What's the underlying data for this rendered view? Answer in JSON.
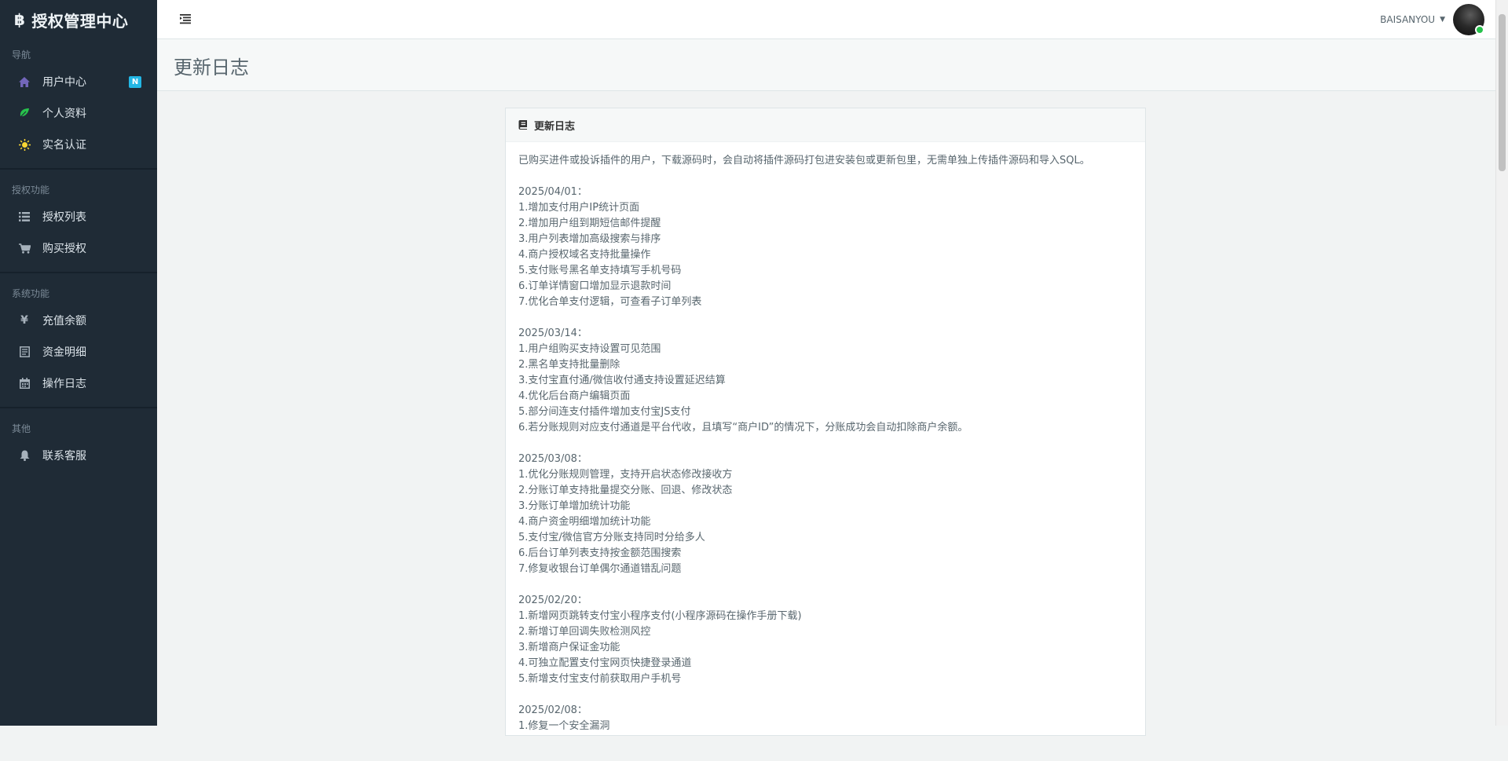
{
  "brand": {
    "logo_glyph": "฿",
    "title": "授权管理中心"
  },
  "sidebar": {
    "sections": [
      {
        "label": "导航",
        "items": [
          {
            "icon": "home-icon",
            "label": "用户中心",
            "badge": "N",
            "icon_color": "#7266ba"
          },
          {
            "icon": "leaf-icon",
            "label": "个人资料",
            "icon_color": "#27c24c"
          },
          {
            "icon": "sun-icon",
            "label": "实名认证",
            "icon_color": "#fad733"
          }
        ]
      },
      {
        "label": "授权功能",
        "items": [
          {
            "icon": "list-icon",
            "label": "授权列表"
          },
          {
            "icon": "cart-icon",
            "label": "购买授权"
          }
        ]
      },
      {
        "label": "系统功能",
        "items": [
          {
            "icon": "yen-icon",
            "label": "充值余额"
          },
          {
            "icon": "ledger-icon",
            "label": "资金明细"
          },
          {
            "icon": "calendar-icon",
            "label": "操作日志"
          }
        ]
      },
      {
        "label": "其他",
        "items": [
          {
            "icon": "bell-icon",
            "label": "联系客服"
          }
        ]
      }
    ]
  },
  "header": {
    "username": "BAISANYOU",
    "caret": "▼"
  },
  "page": {
    "title": "更新日志"
  },
  "panel": {
    "heading": "更新日志",
    "intro": "已购买进件或投诉插件的用户，下载源码时，会自动将插件源码打包进安装包或更新包里，无需单独上传插件源码和导入SQL。",
    "entries": [
      {
        "date": "2025/04/01：",
        "items": [
          "1.增加支付用户IP统计页面",
          "2.增加用户组到期短信邮件提醒",
          "3.用户列表增加高级搜索与排序",
          "4.商户授权域名支持批量操作",
          "5.支付账号黑名单支持填写手机号码",
          "6.订单详情窗口增加显示退款时间",
          "7.优化合单支付逻辑，可查看子订单列表"
        ]
      },
      {
        "date": "2025/03/14：",
        "items": [
          "1.用户组购买支持设置可见范围",
          "2.黑名单支持批量删除",
          "3.支付宝直付通/微信收付通支持设置延迟结算",
          "4.优化后台商户编辑页面",
          "5.部分间连支付插件增加支付宝JS支付",
          "6.若分账规则对应支付通道是平台代收，且填写“商户ID”的情况下，分账成功会自动扣除商户余额。"
        ]
      },
      {
        "date": "2025/03/08：",
        "items": [
          "1.优化分账规则管理，支持开启状态修改接收方",
          "2.分账订单支持批量提交分账、回退、修改状态",
          "3.分账订单增加统计功能",
          "4.商户资金明细增加统计功能",
          "5.支付宝/微信官方分账支持同时分给多人",
          "6.后台订单列表支持按金额范围搜索",
          "7.修复收银台订单偶尔通道错乱问题"
        ]
      },
      {
        "date": "2025/02/20：",
        "items": [
          "1.新增网页跳转支付宝小程序支付(小程序源码在操作手册下载)",
          "2.新增订单回调失败检测风控",
          "3.新增商户保证金功能",
          "4.可独立配置支付宝网页快捷登录通道",
          "5.新增支付宝支付前获取用户手机号"
        ]
      },
      {
        "date": "2025/02/08：",
        "items": [
          "1.修复一个安全漏洞"
        ]
      }
    ]
  }
}
